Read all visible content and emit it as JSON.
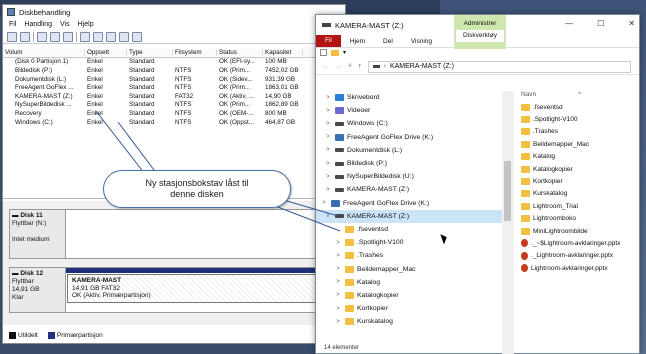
{
  "disk_management": {
    "title": "Diskbehandling",
    "menu": [
      "Fil",
      "Handling",
      "Vis",
      "Hjelp"
    ],
    "columns": [
      "Volum",
      "Oppsett",
      "Type",
      "Filsystem",
      "Status",
      "Kapasitet"
    ],
    "rows": [
      [
        "(Disk 0 Partisjon 1)",
        "Enkel",
        "Standard",
        "",
        "OK (EFI-sy...",
        "100 MB"
      ],
      [
        "Bildedisk (P:)",
        "Enkel",
        "Standard",
        "NTFS",
        "OK (Prim...",
        "7452,02 GB"
      ],
      [
        "Dokumentdisk (L:)",
        "Enkel",
        "Standard",
        "NTFS",
        "OK (Sidev...",
        "931,39 GB"
      ],
      [
        "FreeAgent GoFlex ...",
        "Enkel",
        "Standard",
        "NTFS",
        "OK (Prim...",
        "1863,01 GB"
      ],
      [
        "KAMERA-MAST (Z:)",
        "Enkel",
        "Standard",
        "FAT32",
        "OK (Aktiv, ...",
        "14,90 GB"
      ],
      [
        "NySuperBildedisk ...",
        "Enkel",
        "Standard",
        "NTFS",
        "OK (Prim...",
        "1862,89 GB"
      ],
      [
        "Recovery",
        "Enkel",
        "Standard",
        "NTFS",
        "OK (OEM-...",
        "800 MB"
      ],
      [
        "Windows (C:)",
        "Enkel",
        "Standard",
        "NTFS",
        "OK (Oppst...",
        "464,87 GB"
      ]
    ],
    "disk11": {
      "name": "Disk 11",
      "type": "Flyttbar (N:)",
      "state": "Intet medium"
    },
    "disk12": {
      "name": "Disk 12",
      "type": "Flyttbar",
      "size": "14,91 GB",
      "state": "Klar",
      "partition_name": "KAMERA-MAST",
      "partition_size": "14,91 GB FAT32",
      "partition_status": "OK (Aktiv, Primærpartisjon)"
    },
    "legend": [
      "Utildelt",
      "Primærpartisjon"
    ]
  },
  "callout": {
    "line1": "Ny stasjonsbokstav låst til",
    "line2": "denne disken"
  },
  "explorer": {
    "title": "KAMERA-MAST (Z:)",
    "context_tab": "Administrer",
    "context_sub": "Diskverktøy",
    "ribbon": [
      "Fil",
      "Hjem",
      "Del",
      "Visning"
    ],
    "path": "KAMERA-MAST (Z:)",
    "nav": [
      {
        "label": "Skrivebord",
        "icon": "desktop-icon",
        "arrow": ">"
      },
      {
        "label": "Videoer",
        "icon": "video-icon",
        "arrow": ">"
      },
      {
        "label": "Windows (C:)",
        "icon": "drive-icon",
        "arrow": ">"
      },
      {
        "label": "FreeAgent GoFlex Drive (K:)",
        "icon": "netdrive-icon",
        "arrow": ">"
      },
      {
        "label": "Dokumentdisk (L:)",
        "icon": "drive-icon",
        "arrow": ">"
      },
      {
        "label": "Bildedisk (P:)",
        "icon": "drive-icon",
        "arrow": ">"
      },
      {
        "label": "NySuperBildedisk (U:)",
        "icon": "drive-icon",
        "arrow": ">"
      },
      {
        "label": "KAMERA-MAST (Z:)",
        "icon": "drive-icon",
        "arrow": ">"
      },
      {
        "label": "FreeAgent GoFlex Drive (K:)",
        "icon": "netdrive-icon",
        "arrow": ">"
      },
      {
        "label": "KAMERA-MAST (Z:)",
        "icon": "drive-icon",
        "arrow": "v",
        "selected": true
      },
      {
        "label": ".fseventsd",
        "icon": "folder-icon",
        "arrow": ""
      },
      {
        "label": ".Spotlight-V100",
        "icon": "folder-icon",
        "arrow": ">"
      },
      {
        "label": ".Trashes",
        "icon": "folder-icon",
        "arrow": ">"
      },
      {
        "label": "Beildemapper_Mac",
        "icon": "folder-icon",
        "arrow": ">"
      },
      {
        "label": "Katalog",
        "icon": "folder-icon",
        "arrow": ">"
      },
      {
        "label": "Katalogkopier",
        "icon": "folder-icon",
        "arrow": ">"
      },
      {
        "label": "Kortkopier",
        "icon": "folder-icon",
        "arrow": ">"
      },
      {
        "label": "Kurskatalog",
        "icon": "folder-icon",
        "arrow": ">"
      }
    ],
    "files_header": "Navn",
    "files": [
      {
        "name": ".fseventsd",
        "icon": "folder-icon"
      },
      {
        "name": ".Spotlight-V100",
        "icon": "folder-icon"
      },
      {
        "name": ".Trashes",
        "icon": "folder-icon"
      },
      {
        "name": "Beildemapper_Mac",
        "icon": "folder-icon"
      },
      {
        "name": "Katalog",
        "icon": "folder-icon"
      },
      {
        "name": "Katalogkopier",
        "icon": "folder-icon"
      },
      {
        "name": "Kortkopier",
        "icon": "folder-icon"
      },
      {
        "name": "Kurskatalog",
        "icon": "folder-icon"
      },
      {
        "name": "Lightroom_Trial",
        "icon": "folder-icon"
      },
      {
        "name": "Lightroomboko",
        "icon": "folder-icon"
      },
      {
        "name": "MiniLightroombilde",
        "icon": "folder-icon"
      },
      {
        "name": "._~$Lightroom-avklaringer.pptx",
        "icon": "pptx-icon"
      },
      {
        "name": "._Lightroom-avklaringer.pptx",
        "icon": "pptx-icon"
      },
      {
        "name": "Lightroom-avklaringer.pptx",
        "icon": "pptx-icon"
      }
    ],
    "status": "14 elementer"
  },
  "colors": {
    "primary_partition": "#20307a",
    "unallocated": "#111111",
    "ribbon_file": "#b21414",
    "context_tab": "#cfe8b0"
  }
}
